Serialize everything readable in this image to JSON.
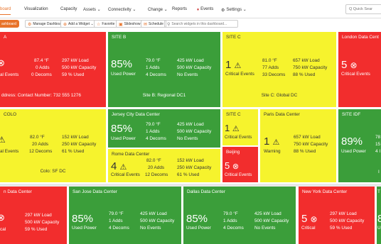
{
  "nav": {
    "items": [
      "board",
      "Visualization",
      "Capacity",
      "Assets ⌄",
      "Connectivity ⌄",
      "Change ⌄",
      "Reports",
      "Events",
      "Settings ⌄"
    ],
    "quick_search_placeholder": "Q Quick Sear"
  },
  "toolbar": {
    "dashboard_label": "ashboard",
    "manage_label": "Manage Dashboards",
    "add_widget_label": "Add a Widget ⌄",
    "favorite_label": "Favorite",
    "slideshow_label": "Slideshow",
    "schedule_label": "Schedule",
    "search_placeholder": "Search widgets in this dashboard..."
  },
  "colors": {
    "red": "#f22d2d",
    "green": "#3b9e3a",
    "yellow": "#f6f32d",
    "orange": "#e8732a"
  },
  "tiles": {
    "t1": {
      "title": "A",
      "temp": "87.4 °F",
      "adds": "0 Adds",
      "decoms": "0 Decoms",
      "load": "297 kW Load",
      "capacity": "500 kW Capacity",
      "used": "59 % Used",
      "crit": "al Events",
      "footer": "ddress: Contact Number: 732 555 1276"
    },
    "t2": {
      "title": "SITE B",
      "pct": "85%",
      "pct_label": "Used Power",
      "temp": "79.0 °F",
      "adds": "1 Adds",
      "decoms": "4 Decoms",
      "load": "425 kW Load",
      "capacity": "500 kW Capacity",
      "events": "No Events",
      "footer": "Site B: Regional DC1"
    },
    "t3": {
      "title": "SITE C",
      "count": "1",
      "count_label": "Critical Events",
      "temp": "81.0 °F",
      "adds": "77 Adds",
      "decoms": "33 Decoms",
      "load": "657 kW Load",
      "capacity": "750 kW Capacity",
      "used": "88 % Used",
      "footer": "Site C: Global DC"
    },
    "t4": {
      "title": "London Data Cent",
      "count": "5",
      "count_label": "Critical Events"
    },
    "t5": {
      "title": "COLO",
      "temp": "82.0 °F",
      "adds": "20 Adds",
      "decoms": "12 Decoms",
      "load": "152 kW Load",
      "capacity": "250 kW Capacity",
      "used": "61 % Used",
      "crit": "al Events",
      "footer": "Colo: SF DC"
    },
    "t6": {
      "title": "Jersey City Data Center",
      "pct": "85%",
      "pct_label": "Used Power",
      "temp": "79.0 °F",
      "adds": "1 Adds",
      "decoms": "4 Decoms",
      "load": "425 kW Load",
      "capacity": "500 kW Capacity",
      "events": "No Events"
    },
    "t7": {
      "title": "SITE C",
      "count": "1",
      "count_label": "Critical Events"
    },
    "t8": {
      "title": "Paris Data Center",
      "count": "1",
      "count_label": "Warning",
      "load": "657 kW Load",
      "capacity": "750 kW Capacity",
      "used": "88 % Used"
    },
    "t9": {
      "title": "SITE IDF",
      "pct": "89%",
      "pct_label": "Used Power",
      "temp": "78",
      "adds": "15",
      "decoms": "4 I",
      "footer": "I"
    },
    "t10": {
      "title": "Rome Data Center",
      "count": "4",
      "count_label": "Critical Events",
      "temp": "82.0 °F",
      "adds": "20 Adds",
      "decoms": "12 Decoms",
      "load": "152 kW Load",
      "capacity": "250 kW Capacity",
      "used": "61 % Used"
    },
    "t11": {
      "title": "Beijing",
      "count": "5",
      "count_label": "Critical Events"
    },
    "t12": {
      "title": "n Data Center",
      "load": "297 kW Load",
      "capacity": "500 kW Capacity",
      "used": "59 % Used",
      "crit": "cal"
    },
    "t13": {
      "title": "San Jose Data Center",
      "pct": "85%",
      "pct_label": "Used Power",
      "temp": "79.0 °F",
      "adds": "1 Adds",
      "decoms": "4 Decoms",
      "load": "425 kW Load",
      "capacity": "500 kW Capacity",
      "events": "No Events"
    },
    "t14": {
      "title": "Dallas Data Center",
      "pct": "85%",
      "pct_label": "Used Power",
      "temp": "79.0 °F",
      "adds": "1 Adds",
      "decoms": "4 Decoms",
      "load": "425 kW Load",
      "capacity": "500 kW Capacity",
      "events": "No Events"
    },
    "t15": {
      "title": "New York Data Center",
      "count": "5",
      "count_label": "Critical",
      "load": "297 kW Load",
      "capacity": "500 kW Capacity",
      "used": "59 % Used"
    },
    "t16": {
      "title": "T",
      "pct": "8",
      "pct_label": "U"
    }
  }
}
